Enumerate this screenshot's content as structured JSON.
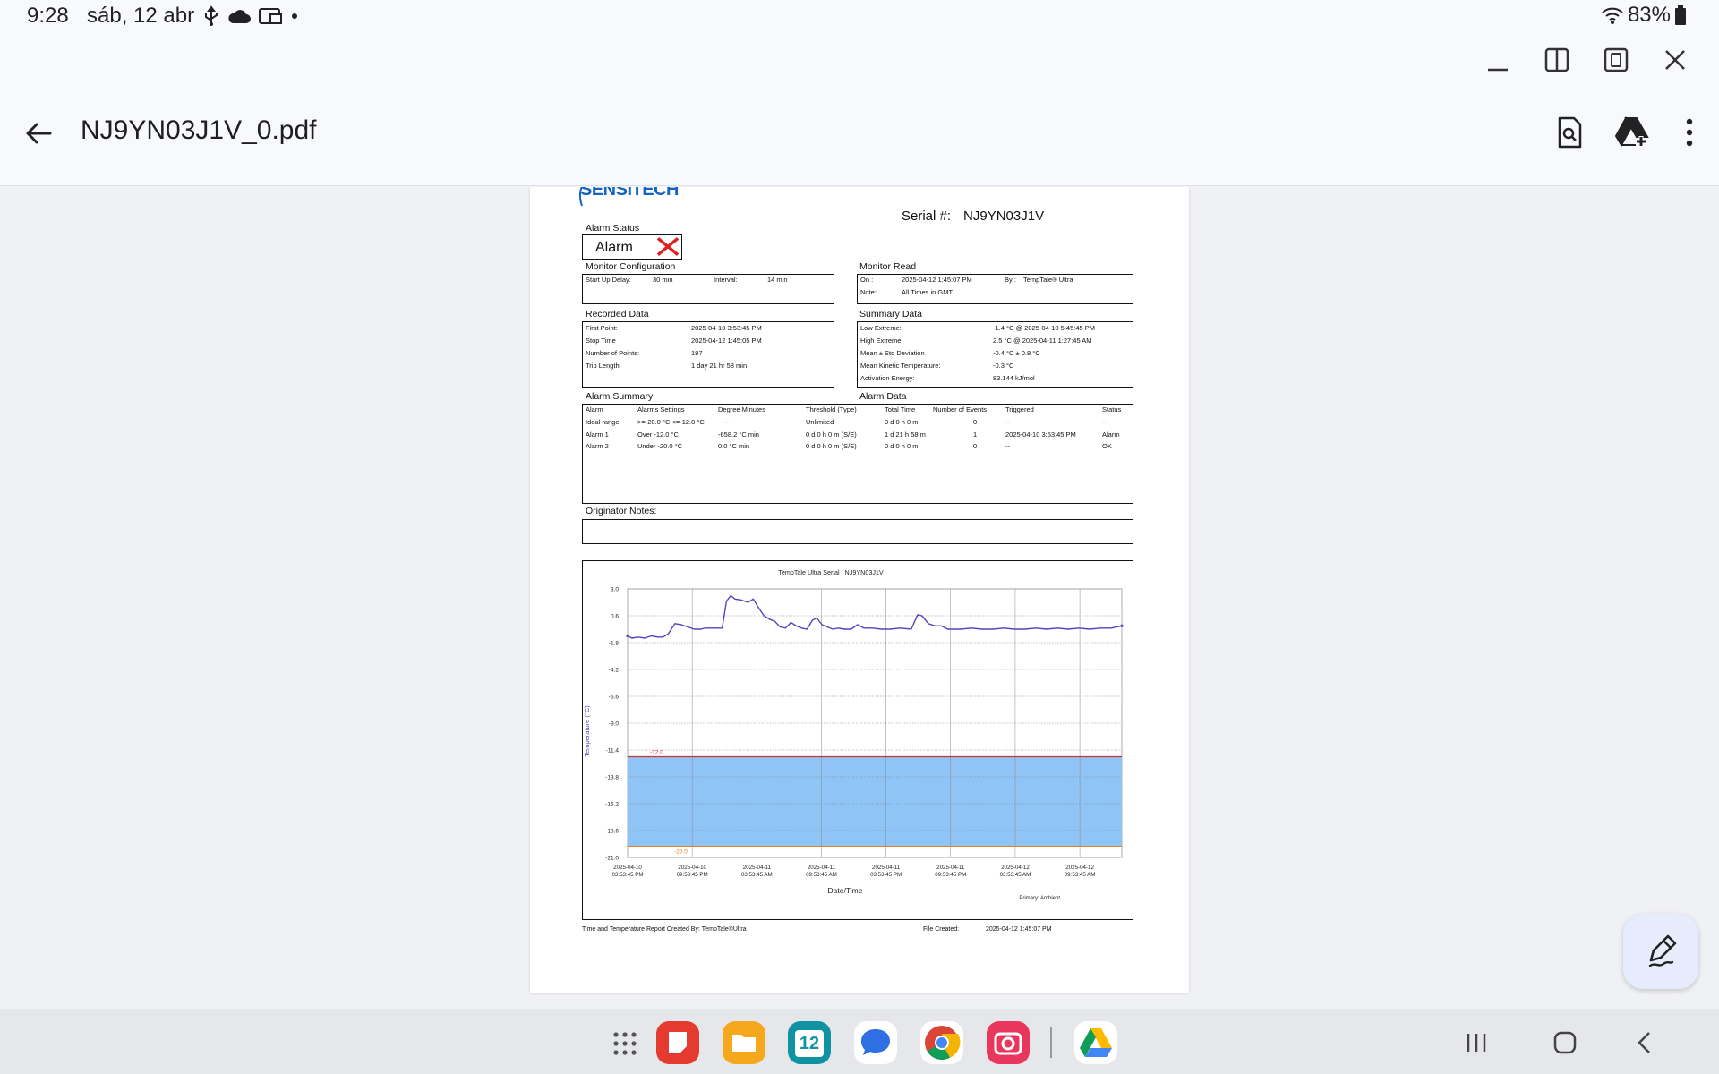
{
  "status_bar": {
    "time": "9:28",
    "date": "sáb, 12 abr",
    "battery": "83%",
    "icons": [
      "usb-icon",
      "cloud-icon",
      "cast-icon",
      "dot-icon",
      "wifi-icon",
      "battery-icon"
    ]
  },
  "app_bar": {
    "title": "NJ9YN03J1V_0.pdf",
    "actions": [
      "search-document-icon",
      "drive-add-icon",
      "more-vert-icon"
    ]
  },
  "window_controls": [
    "minimize-icon",
    "split-view-icon",
    "popup-view-icon",
    "close-icon"
  ],
  "document": {
    "logo": "SENSITECH",
    "serial_label": "Serial #:",
    "serial_value": "NJ9YN03J1V",
    "alarm_status_label": "Alarm Status",
    "alarm_status_value": "Alarm",
    "monitor_config": {
      "label": "Monitor Configuration",
      "startup_delay_label": "Start Up Delay:",
      "startup_delay_value": "30 min",
      "interval_label": "Interval:",
      "interval_value": "14 min"
    },
    "monitor_read": {
      "label": "Monitor Read",
      "on_label": "On :",
      "on_value": "2025-04-12 1:45:07 PM",
      "by_label": "By :",
      "by_value": "TempTale® Ultra",
      "note_label": "Note:",
      "note_value": "All Times in GMT"
    },
    "recorded_data": {
      "label": "Recorded Data",
      "rows": [
        {
          "k": "First Point:",
          "v": "2025-04-10 3:53:45 PM"
        },
        {
          "k": "Stop Time",
          "v": "2025-04-12 1:45:05 PM"
        },
        {
          "k": "Number of Points:",
          "v": "197"
        },
        {
          "k": "Trip Length:",
          "v": "1 day 21 hr 58 min"
        }
      ]
    },
    "summary_data": {
      "label": "Summary Data",
      "rows": [
        {
          "k": "Low Extreme:",
          "v": "-1.4 °C @ 2025-04-10 5:45:45 PM"
        },
        {
          "k": "High Extreme:",
          "v": "2.5 °C @ 2025-04-11 1:27:45 AM"
        },
        {
          "k": "Mean ± Std Deviation",
          "v": "-0.4 °C ± 0.8 °C"
        },
        {
          "k": "Mean Kinetic Temperature:",
          "v": "-0.3 °C"
        },
        {
          "k": "Activation Energy:",
          "v": "83.144 kJ/mol"
        }
      ]
    },
    "alarm_summary": {
      "label": "Alarm Summary",
      "headers": [
        "Alarm",
        "Alarms Settings",
        "Degree Minutes"
      ],
      "rows": [
        [
          "Ideal range",
          ">=-20.0 °C <=-12.0 °C",
          "--"
        ],
        [
          "Alarm 1",
          "Over -12.0 °C",
          "-658.2 °C min"
        ],
        [
          "Alarm 2",
          "Under -20.0 °C",
          "0.0 °C min"
        ]
      ]
    },
    "alarm_data": {
      "label": "Alarm Data",
      "headers": [
        "Threshold (Type)",
        "Total Time",
        "Number of Events",
        "Triggered",
        "Status"
      ],
      "rows": [
        [
          "Unlimited",
          "0 d 0 h 0 m",
          "0",
          "--",
          "--"
        ],
        [
          "0 d 0 h 0 m (S/E)",
          "1 d 21 h 58 m",
          "1",
          "2025-04-10  3:53:45 PM",
          "Alarm"
        ],
        [
          "0 d 0 h 0 m (S/E)",
          "0 d 0 h 0 m",
          "0",
          "--",
          "OK"
        ]
      ]
    },
    "originator_notes_label": "Originator Notes:",
    "footer_left": "Time and Temperature Report Created By:  TempTale®Ultra",
    "footer_file_label": "File Created:",
    "footer_file_value": "2025-04-12  1:45:07 PM"
  },
  "chart_data": {
    "type": "line",
    "title": "TempTale Ultra  Serial : NJ9YN03J1V",
    "xlabel": "Date/Time",
    "ylabel": "Temperature (°C)",
    "primary_label": "Primary: Ambient",
    "ylim": [
      -21.0,
      3.0
    ],
    "yticks": [
      "3.0",
      "0.6",
      "-1.8",
      "-4.2",
      "-6.6",
      "-9.0",
      "-11.4",
      "-13.8",
      "-16.2",
      "-18.6",
      "-21.0"
    ],
    "xlim_hours": [
      0,
      46
    ],
    "xticks": [
      [
        "2025-04-10",
        "03:53:45 PM"
      ],
      [
        "2025-04-10",
        "09:53:45 PM"
      ],
      [
        "2025-04-11",
        "03:53:45 AM"
      ],
      [
        "2025-04-11",
        "09:53:45 AM"
      ],
      [
        "2025-04-11",
        "03:53:45 PM"
      ],
      [
        "2025-04-11",
        "09:53:45 PM"
      ],
      [
        "2025-04-12",
        "03:53:45 AM"
      ],
      [
        "2025-04-12",
        "09:53:45 AM"
      ]
    ],
    "upper_limit": -12.0,
    "upper_limit_label": "-12.0",
    "lower_limit": -20.0,
    "lower_limit_label": "-20.0",
    "grid": true,
    "series": [
      {
        "values": [
          [
            0.0,
            -1.2
          ],
          [
            0.4,
            -1.4
          ],
          [
            1.0,
            -1.3
          ],
          [
            1.6,
            -1.4
          ],
          [
            2.2,
            -1.2
          ],
          [
            2.8,
            -1.3
          ],
          [
            3.3,
            -1.3
          ],
          [
            3.8,
            -1.0
          ],
          [
            4.4,
            -0.1
          ],
          [
            5.0,
            -0.2
          ],
          [
            5.6,
            -0.4
          ],
          [
            6.2,
            -0.6
          ],
          [
            6.8,
            -0.6
          ],
          [
            7.2,
            -0.5
          ],
          [
            8.4,
            -0.5
          ],
          [
            8.8,
            -0.5
          ],
          [
            9.2,
            1.9
          ],
          [
            9.6,
            2.4
          ],
          [
            10.0,
            2.1
          ],
          [
            10.6,
            2.0
          ],
          [
            11.2,
            1.8
          ],
          [
            11.7,
            2.1
          ],
          [
            12.2,
            1.3
          ],
          [
            12.7,
            0.6
          ],
          [
            13.2,
            0.3
          ],
          [
            13.7,
            0.1
          ],
          [
            14.2,
            -0.4
          ],
          [
            14.7,
            -0.5
          ],
          [
            15.2,
            0.0
          ],
          [
            15.7,
            -0.3
          ],
          [
            16.2,
            -0.5
          ],
          [
            16.7,
            -0.6
          ],
          [
            17.2,
            0.2
          ],
          [
            17.6,
            0.4
          ],
          [
            18.1,
            -0.2
          ],
          [
            18.6,
            -0.4
          ],
          [
            19.1,
            -0.6
          ],
          [
            19.6,
            -0.5
          ],
          [
            20.2,
            -0.6
          ],
          [
            20.8,
            -0.6
          ],
          [
            21.4,
            -0.2
          ],
          [
            22.0,
            -0.5
          ],
          [
            22.8,
            -0.5
          ],
          [
            23.6,
            -0.6
          ],
          [
            24.4,
            -0.6
          ],
          [
            25.4,
            -0.5
          ],
          [
            26.4,
            -0.6
          ],
          [
            27.0,
            0.7
          ],
          [
            27.4,
            0.6
          ],
          [
            28.0,
            -0.1
          ],
          [
            28.6,
            -0.3
          ],
          [
            29.2,
            -0.3
          ],
          [
            29.8,
            -0.6
          ],
          [
            31.0,
            -0.6
          ],
          [
            32.0,
            -0.5
          ],
          [
            33.0,
            -0.6
          ],
          [
            34.0,
            -0.6
          ],
          [
            35.0,
            -0.5
          ],
          [
            36.0,
            -0.6
          ],
          [
            37.0,
            -0.6
          ],
          [
            38.0,
            -0.5
          ],
          [
            39.0,
            -0.6
          ],
          [
            40.0,
            -0.5
          ],
          [
            41.0,
            -0.6
          ],
          [
            42.0,
            -0.5
          ],
          [
            43.0,
            -0.6
          ],
          [
            44.0,
            -0.5
          ],
          [
            45.0,
            -0.5
          ],
          [
            46.0,
            -0.3
          ]
        ]
      }
    ]
  },
  "nav_bar": {
    "calendar_day": "12",
    "dock_apps": [
      "app-drawer-icon",
      "notes-app-icon",
      "files-app-icon",
      "calendar-app-icon",
      "messages-app-icon",
      "chrome-app-icon",
      "camera-app-icon",
      "drive-app-icon"
    ],
    "nav_buttons": [
      "recents-icon",
      "home-icon",
      "back-nav-icon"
    ]
  }
}
